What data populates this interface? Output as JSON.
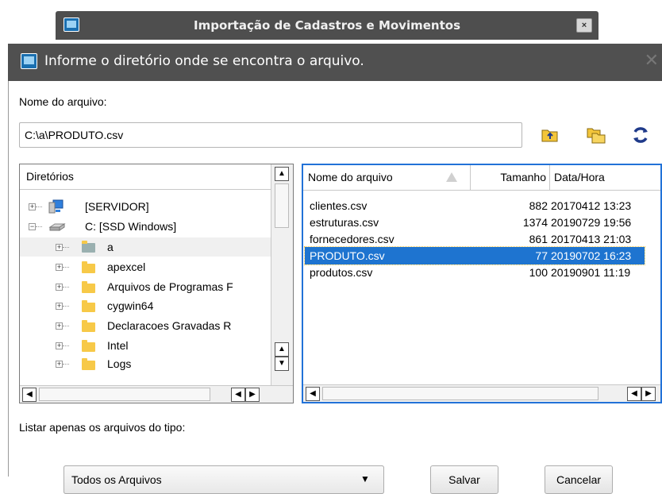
{
  "back_window": {
    "title": "Importação de Cadastros e Movimentos",
    "close_label": "×"
  },
  "dialog": {
    "title": "Informe o diretório onde se encontra o arquivo.",
    "close_label": "✕",
    "filename_label": "Nome do arquivo:",
    "path_value": "C:\\a\\PRODUTO.csv",
    "toolbar_icons": [
      "folder-up-icon",
      "copy-folder-icon",
      "refresh-icon"
    ]
  },
  "directories": {
    "header": "Diretórios",
    "items": [
      {
        "label": "[SERVIDOR]",
        "icon": "network-server-icon",
        "level": 0
      },
      {
        "label": "C: [SSD Windows]",
        "icon": "drive-icon",
        "level": 0
      },
      {
        "label": "a",
        "icon": "folder-icon",
        "level": 1
      },
      {
        "label": "apexcel",
        "icon": "folder-icon",
        "level": 1
      },
      {
        "label": "Arquivos de Programas F",
        "icon": "folder-icon",
        "level": 1
      },
      {
        "label": "cygwin64",
        "icon": "folder-icon",
        "level": 1
      },
      {
        "label": "Declaracoes Gravadas R",
        "icon": "folder-icon",
        "level": 1
      },
      {
        "label": "Intel",
        "icon": "folder-icon",
        "level": 1
      },
      {
        "label": "Logs",
        "icon": "folder-icon",
        "level": 1
      }
    ]
  },
  "files": {
    "columns": [
      "Nome do arquivo",
      "Tamanho",
      "Data/Hora"
    ],
    "rows": [
      {
        "name": "clientes.csv",
        "size": "882",
        "date": "20170412 13:23"
      },
      {
        "name": "estruturas.csv",
        "size": "1374",
        "date": "20190729 19:56"
      },
      {
        "name": "fornecedores.csv",
        "size": "861",
        "date": "20170413 21:03"
      },
      {
        "name": "PRODUTO.csv",
        "size": "77",
        "date": "20190702 16:23"
      },
      {
        "name": "produtos.csv",
        "size": "100",
        "date": "20190901 11:19"
      }
    ],
    "selected_index": 3
  },
  "filter": {
    "label": "Listar apenas os arquivos do tipo:",
    "selected": "Todos os Arquivos"
  },
  "buttons": {
    "save": "Salvar",
    "cancel": "Cancelar"
  },
  "colors": {
    "title_bar": "#505050",
    "selection": "#1e74d0",
    "folder": "#f7c948"
  }
}
